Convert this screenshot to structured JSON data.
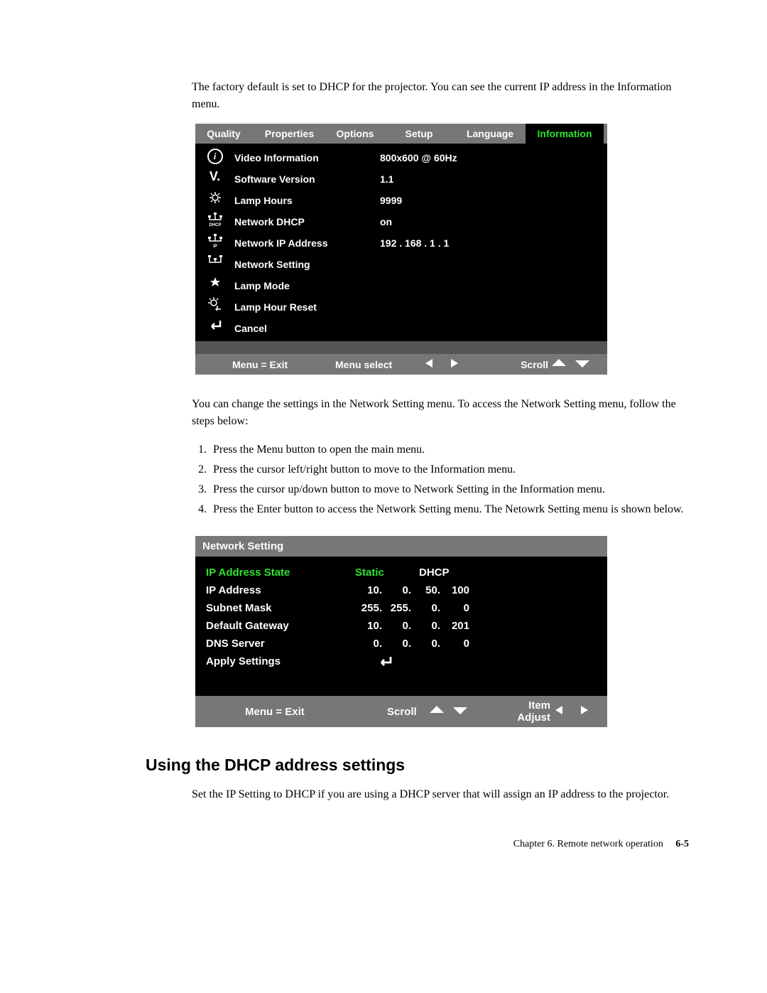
{
  "intro": "The factory default is set to DHCP for the projector. You can see the current IP address in the Information menu.",
  "osd1": {
    "tabs": [
      "Quality",
      "Properties",
      "Options",
      "Setup",
      "Language",
      "Information"
    ],
    "rows": [
      {
        "label": "Video Information",
        "value": "800x600 @ 60Hz"
      },
      {
        "label": "Software Version",
        "value": "1.1"
      },
      {
        "label": "Lamp Hours",
        "value": "9999"
      },
      {
        "label": "Network DHCP",
        "value": "on"
      },
      {
        "label": "Network IP Address",
        "value": "192 . 168 . 1 . 1"
      },
      {
        "label": "Network Setting",
        "value": ""
      },
      {
        "label": "Lamp Mode",
        "value": ""
      },
      {
        "label": "Lamp Hour Reset",
        "value": ""
      },
      {
        "label": "Cancel",
        "value": ""
      }
    ],
    "footer": {
      "menu": "Menu = Exit",
      "select": "Menu select",
      "scroll": "Scroll"
    }
  },
  "mid1": "You can change the settings in the Network Setting menu. To access the Network Setting menu, follow the steps below:",
  "steps": [
    "Press the Menu button to open the main menu.",
    "Press the cursor left/right button to move to the Information menu.",
    "Press the cursor up/down button to move to Network Setting in the Information menu.",
    "Press the Enter button to access the Network Setting menu. The Netowrk Setting menu is shown below."
  ],
  "osd2": {
    "title": "Network Setting",
    "rows": {
      "state_label": "IP Address State",
      "state_v1": "Static",
      "state_v2": "DHCP",
      "ip_label": "IP Address",
      "ip_val": [
        "10.",
        "0.",
        "50.",
        "100"
      ],
      "mask_label": "Subnet Mask",
      "mask_val": [
        "255.",
        "255.",
        "0.",
        "0"
      ],
      "gw_label": "Default Gateway",
      "gw_val": [
        "10.",
        "0.",
        "0.",
        "201"
      ],
      "dns_label": "DNS Server",
      "dns_val": [
        "0.",
        "0.",
        "0.",
        "0"
      ],
      "apply_label": "Apply Settings"
    },
    "footer": {
      "menu": "Menu = Exit",
      "scroll": "Scroll",
      "adjust": "Item Adjust"
    }
  },
  "section_heading": "Using the DHCP address settings",
  "section_text": "Set the IP Setting to DHCP if you are using a DHCP server that will assign an IP address to the projector.",
  "footer_chapter": "Chapter 6. Remote network operation",
  "footer_page": "6-5"
}
